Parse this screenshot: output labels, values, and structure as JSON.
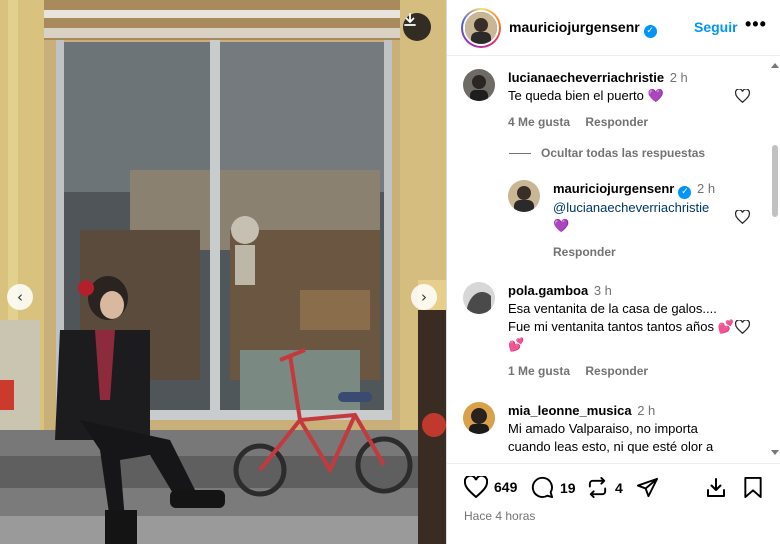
{
  "header": {
    "username": "mauriciojurgensenr",
    "follow_label": "Seguir",
    "more_label": "•••"
  },
  "photo": {
    "download_icon": "download-icon",
    "prev_icon": "chevron-left-icon",
    "next_icon": "chevron-right-icon",
    "prev_label": "‹",
    "next_label": "›"
  },
  "comments": [
    {
      "username": "lucianaecheverriachristie",
      "time": "2 h",
      "text": "Te queda bien el puerto 💜",
      "likes": "4 Me gusta",
      "reply": "Responder"
    },
    {
      "hide_replies": "Ocultar todas las respuestas"
    },
    {
      "username": "mauriciojurgensenr",
      "time": "2 h",
      "mention": "@lucianaecheverriachristie",
      "text": "💜",
      "reply": "Responder"
    },
    {
      "username": "pola.gamboa",
      "time": "3 h",
      "text": "Esa ventanita de la casa de galos.... Fue mi ventanita tantos tantos años 💕💕",
      "likes": "1 Me gusta",
      "reply": "Responder"
    },
    {
      "username": "mia_leonne_musica",
      "time": "2 h",
      "text": "Mi amado Valparaiso, no importa cuando leas esto, ni que esté olor a"
    }
  ],
  "actions": {
    "likes": "649",
    "comments": "19",
    "reposts": "4",
    "time_ago": "Hace 4 horas"
  },
  "colors": {
    "accent": "#0095f6",
    "muted": "#737373",
    "mention": "#00376b"
  }
}
